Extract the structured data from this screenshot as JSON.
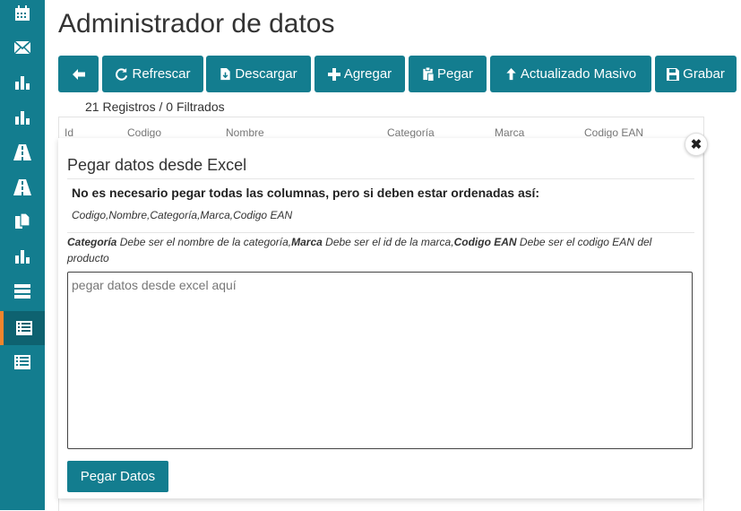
{
  "page": {
    "title": "Administrador de datos"
  },
  "sidebar": {
    "items": [
      {
        "icon": "calendar-icon"
      },
      {
        "icon": "envelope-icon"
      },
      {
        "icon": "bar-chart-icon"
      },
      {
        "icon": "bar-chart-icon"
      },
      {
        "icon": "road-icon"
      },
      {
        "icon": "road-icon"
      },
      {
        "icon": "copy-files-icon"
      },
      {
        "icon": "bar-chart-icon"
      },
      {
        "icon": "server-icon"
      },
      {
        "icon": "table-list-icon",
        "active": true
      },
      {
        "icon": "table-list-icon"
      }
    ],
    "colors": {
      "background": "#137d8f",
      "active": "#0e6270",
      "active_marker": "#f0852d"
    }
  },
  "toolbar": {
    "back_label": "",
    "refresh_label": "Refrescar",
    "download_label": "Descargar",
    "add_label": "Agregar",
    "paste_label": "Pegar",
    "bulk_update_label": "Actualizado Masivo",
    "save_label": "Grabar",
    "accent": "#137d8f"
  },
  "records": {
    "count_text": "21 Registros",
    "filtered_text": "/ 0 Filtrados"
  },
  "table": {
    "columns": [
      "Id",
      "Codigo",
      "Nombre",
      "Categoría",
      "Marca",
      "Codigo EAN"
    ]
  },
  "modal": {
    "title": "Pegar datos desde Excel",
    "instruction": "No es necesario pegar todas las columnas, pero si deben estar ordenadas así:",
    "columns_order": "Codigo,Nombre,Categoría,Marca,Codigo EAN",
    "note_field1": "Categoría",
    "note_text1": " Debe ser el nombre de la categoría,",
    "note_field2": "Marca",
    "note_text2": " Debe ser el id de la marca,",
    "note_field3": "Codigo EAN",
    "note_text3": " Debe ser el codigo EAN del producto",
    "textarea_placeholder": "pegar datos desde excel aquí",
    "submit_label": "Pegar Datos",
    "close_label": "✖"
  }
}
